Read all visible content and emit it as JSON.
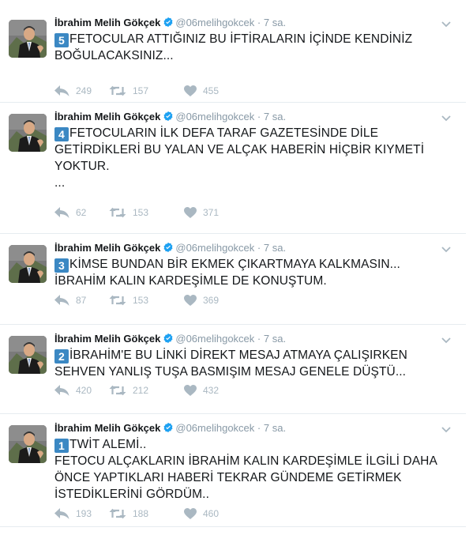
{
  "author": {
    "name": "İbrahim Melih Gökçek",
    "handle": "@06melihgokcek",
    "separator": "·"
  },
  "icons": {
    "verified": "verified-badge-icon",
    "caret": "chevron-down-icon",
    "reply": "reply-icon",
    "retweet": "retweet-icon",
    "like": "heart-icon"
  },
  "colors": {
    "number_badge": "#3b88c3",
    "verified": "#1da1f2",
    "action_icon": "#aab8c2",
    "muted_text": "#8899a6"
  },
  "tweets": [
    {
      "time": "7 sa.",
      "number": "5",
      "lines": [
        "FETOCULAR ATTIĞINIZ BU İFTİRALARIN İÇİNDE KENDİNİZ",
        "BOĞULACAKSINIZ..."
      ],
      "replies": "249",
      "retweets": "157",
      "likes": "455"
    },
    {
      "time": "7 sa.",
      "number": "4",
      "lines": [
        "FETOCULARIN İLK DEFA TARAF GAZETESİNDE DİLE",
        "GETİRDİKLERİ BU YALAN VE ALÇAK HABERİN HİÇBİR KIYMETİ",
        "YOKTUR.",
        "..."
      ],
      "replies": "62",
      "retweets": "153",
      "likes": "371"
    },
    {
      "time": "7 sa.",
      "number": "3",
      "lines": [
        "KİMSE BUNDAN BİR EKMEK ÇIKARTMAYA KALKMASIN...",
        "İBRAHİM KALIN KARDEŞİMLE DE KONUŞTUM."
      ],
      "replies": "87",
      "retweets": "153",
      "likes": "369"
    },
    {
      "time": "7 sa.",
      "number": "2",
      "lines": [
        "İBRAHİM'E BU LİNKİ DİREKT MESAJ ATMAYA ÇALIŞIRKEN",
        "SEHVEN YANLIŞ TUŞA BASMIŞIM MESAJ GENELE DÜŞTÜ..."
      ],
      "replies": "420",
      "retweets": "212",
      "likes": "432"
    },
    {
      "time": "7 sa.",
      "number": "1",
      "lines": [
        "TWİT ALEMİ..",
        "FETOCU ALÇAKLARIN İBRAHİM KALIN KARDEŞİMLE İLGİLİ DAHA",
        "ÖNCE YAPTIKLARI HABERİ TEKRAR GÜNDEME GETİRMEK",
        "İSTEDİKLERİNİ GÖRDÜM.."
      ],
      "replies": "193",
      "retweets": "188",
      "likes": "460"
    }
  ]
}
